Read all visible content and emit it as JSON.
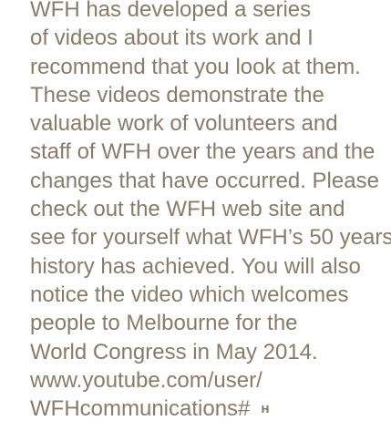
{
  "article": {
    "lines": [
      "WFH has developed a series",
      "of videos about its work and I",
      "recommend that you look at them.",
      "These videos demonstrate the",
      "valuable work of volunteers and",
      "staff of WFH over the years and the",
      "changes that have occurred. Please",
      "check out the WFH web site and",
      "see for yourself what WFH’s 50 years",
      "history has achieved. You will also",
      "notice the video which welcomes",
      "people to Melbourne for the",
      "World Congress in May 2014.",
      "www.youtube.com/user/",
      "WFHcommunications#"
    ],
    "end_mark": "H"
  },
  "colors": {
    "text": "#8a7b68",
    "background": "#ffffff"
  }
}
